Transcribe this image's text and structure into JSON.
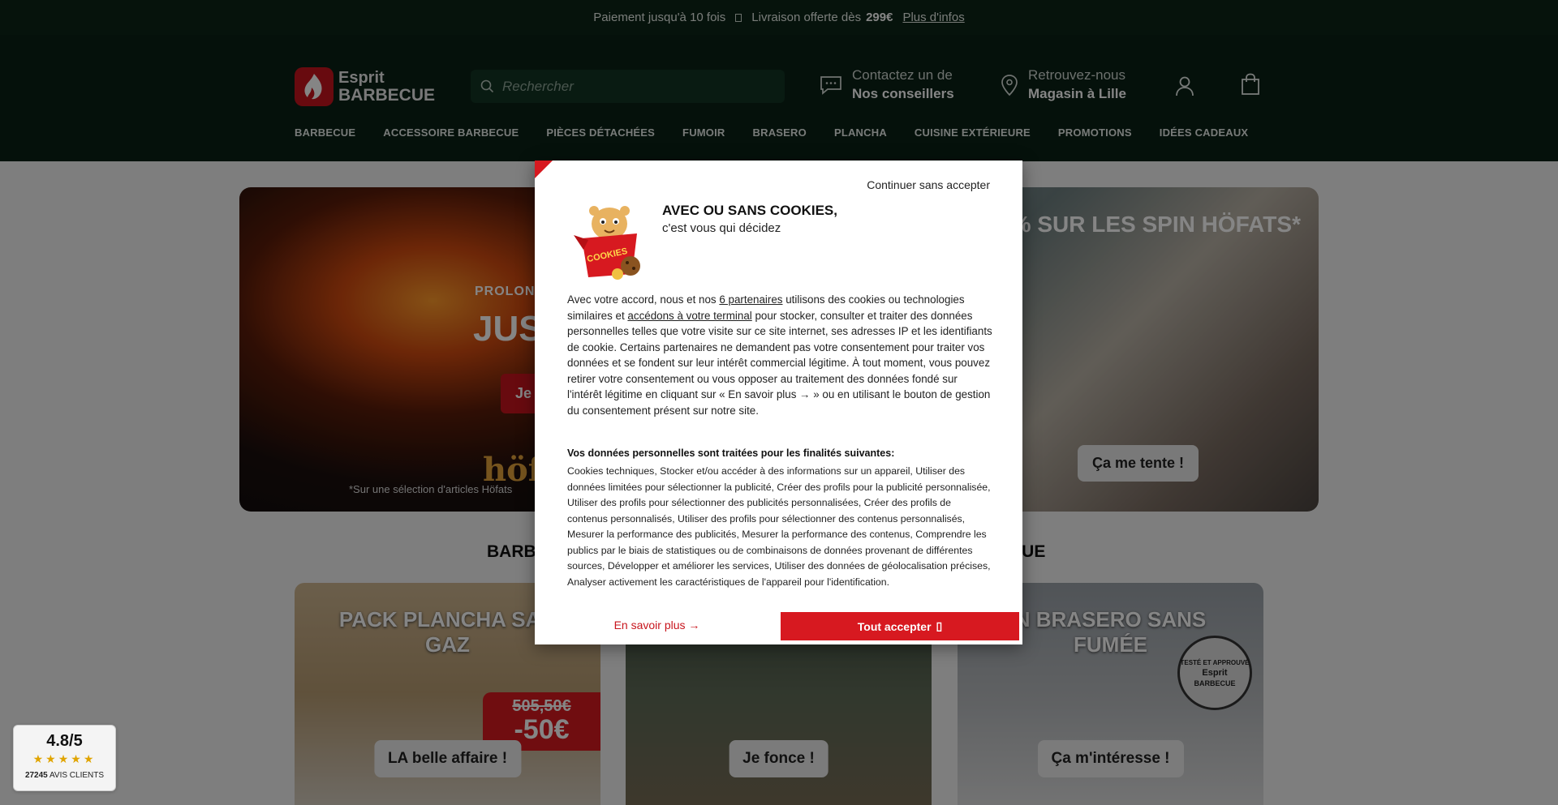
{
  "topbar": {
    "payment": "Paiement jusqu'à 10 fois",
    "delivery_prefix": "Livraison offerte dès",
    "delivery_amount": "299€",
    "more_link": "Plus d'infos"
  },
  "header": {
    "logo_line1": "Esprit",
    "logo_line2": "BARBECUE",
    "search_placeholder": "Rechercher",
    "contact_line1": "Contactez un de",
    "contact_line2": "Nos conseillers",
    "store_line1": "Retrouvez-nous",
    "store_line2": "Magasin à Lille"
  },
  "nav": {
    "items": [
      "BARBECUE",
      "ACCESSOIRE BARBECUE",
      "PIÈCES DÉTACHÉES",
      "FUMOIR",
      "BRASERO",
      "PLANCHA",
      "CUISINE EXTÉRIEURE",
      "PROMOTIONS",
      "IDÉES CADEAUX"
    ]
  },
  "hero_left": {
    "kicker": "PROLON",
    "big": "JUS",
    "cta": "Je",
    "brand": "höfa",
    "note": "*Sur une sélection d'articles Höfats"
  },
  "hero_right": {
    "headline": "% SUR LES SPIN HÖFATS*",
    "cta": "Ça me tente !"
  },
  "section": {
    "title_left": "BARB",
    "title_right": "ECUE"
  },
  "cards": [
    {
      "title_l1": "PACK PLANCHA SAN",
      "title_l2": "GAZ",
      "old_price": "505,50€",
      "discount": "-50€",
      "button": "LA belle affaire !"
    },
    {
      "button": "Je fonce !"
    },
    {
      "title_l1": "N BRASERO SANS",
      "title_l2": "FUMÉE",
      "badge_l1": "TESTÉ ET APPROUVÉ",
      "badge_l2": "Esprit",
      "badge_l3": "BARBECUE",
      "button": "Ça m'intéresse !"
    }
  ],
  "rating": {
    "score": "4.8/5",
    "stars": "★★★★★",
    "count": "27245",
    "count_label": "AVIS CLIENTS"
  },
  "cookie_modal": {
    "skip": "Continuer sans accepter",
    "mascot_label": "COOKIES",
    "title": "AVEC OU SANS COOKIES,",
    "subtitle": "c'est vous qui décidez",
    "body_part1": "Avec votre accord, nous et nos ",
    "partners_link": "6 partenaires",
    "body_part2": " utilisons des cookies ou technologies similaires et ",
    "terminal_link": "accédons à votre terminal",
    "body_part3": " pour stocker, consulter et traiter des données personnelles telles que votre visite sur ce site internet, ses adresses IP et les identifiants de cookie. Certains partenaires ne demandent pas votre consentement pour traiter vos données et se fondent sur leur intérêt commercial légitime. À tout moment, vous pouvez retirer votre consentement ou vous opposer au traitement des données fondé sur l'intérêt légitime en cliquant sur « En savoir plus → » ou en utilisant le bouton de gestion du consentement présent sur notre site.",
    "purposes_title": "Vos données personnelles sont traitées pour les finalités suivantes:",
    "purposes": "Cookies techniques, Stocker et/ou accéder à des informations sur un appareil, Utiliser des données limitées pour sélectionner la publicité, Créer des profils pour la publicité personnalisée, Utiliser des profils pour sélectionner des publicités personnalisées, Créer des profils de contenus personnalisés, Utiliser des profils pour sélectionner des contenus personnalisés, Mesurer la performance des publicités, Mesurer la performance des contenus, Comprendre les publics par le biais de statistiques ou de combinaisons de données provenant de différentes sources, Développer et améliorer les services, Utiliser des données de géolocalisation précises, Analyser activement les caractéristiques de l'appareil pour l'identification.",
    "more": "En savoir plus →",
    "accept": "Tout accepter",
    "accept_icon": "▯"
  }
}
